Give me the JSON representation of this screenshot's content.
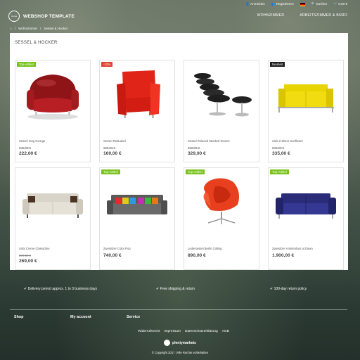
{
  "topbar": {
    "login": "Anmelden",
    "register": "Registrieren",
    "search": "Suchen",
    "cart": "0,00 €"
  },
  "brand": {
    "name": "WEBSHOP TEMPLATE",
    "logo_small": "Ceres"
  },
  "nav": {
    "items": [
      "WOHNZIMMER",
      "ARBEITSZIMMER & BÜRO"
    ]
  },
  "breadcrumb": {
    "items": [
      "Wohnzimmer",
      "Sessel & Hocker"
    ]
  },
  "category": {
    "title": "SESSEL & HOCKER"
  },
  "products": [
    {
      "name": "Sessel King George",
      "old_price": "345,00 €",
      "price": "222,00 €",
      "badge": "Top-Artikel",
      "badge_type": "green"
    },
    {
      "name": "Sessel RedLabel",
      "old_price": "190,00 €",
      "price": "169,00 €",
      "badge": "-12%",
      "badge_type": "red"
    },
    {
      "name": "Sessel Relaxed Stacked Stones",
      "old_price": "393,00 €",
      "price": "329,00 €",
      "badge": "",
      "badge_type": ""
    },
    {
      "name": "Sofa 2-Sitzer Sunflower",
      "old_price": "349,00 €",
      "price": "335,00 €",
      "badge": "Neuheit",
      "badge_type": "dark"
    },
    {
      "name": "Sofa Creme Classicline",
      "old_price": "289,00 €",
      "price": "269,00 €",
      "badge": "",
      "badge_type": ""
    },
    {
      "name": "Zweisitzer Color Pop",
      "old_price": "",
      "price": "740,00 €",
      "badge": "Top-Artikel",
      "badge_type": "green"
    },
    {
      "name": "Ledersessel Berlin Calling",
      "old_price": "",
      "price": "890,00 €",
      "badge": "Top-Artikel",
      "badge_type": "green"
    },
    {
      "name": "Zweisitzer Amsterdam at Dawn",
      "old_price": "",
      "price": "1.900,00 €",
      "badge": "Top-Artikel",
      "badge_type": "green"
    }
  ],
  "perks": [
    "Delivery period approx. 1 to 3 business days",
    "Free shipping & return",
    "100-day return policy"
  ],
  "footer": {
    "columns": [
      "Shop",
      "My account",
      "Service"
    ],
    "links": [
      "Widerrufsrecht",
      "Impressum",
      "Datenschutzerklärung",
      "AGB"
    ],
    "powered": "plentymarkets",
    "copyright": "© Copyright 2017 | Alle Rechte vorbehalten"
  },
  "colors": {
    "badge_green": "#7ac41f",
    "badge_red": "#e04535",
    "badge_dark": "#222222"
  }
}
